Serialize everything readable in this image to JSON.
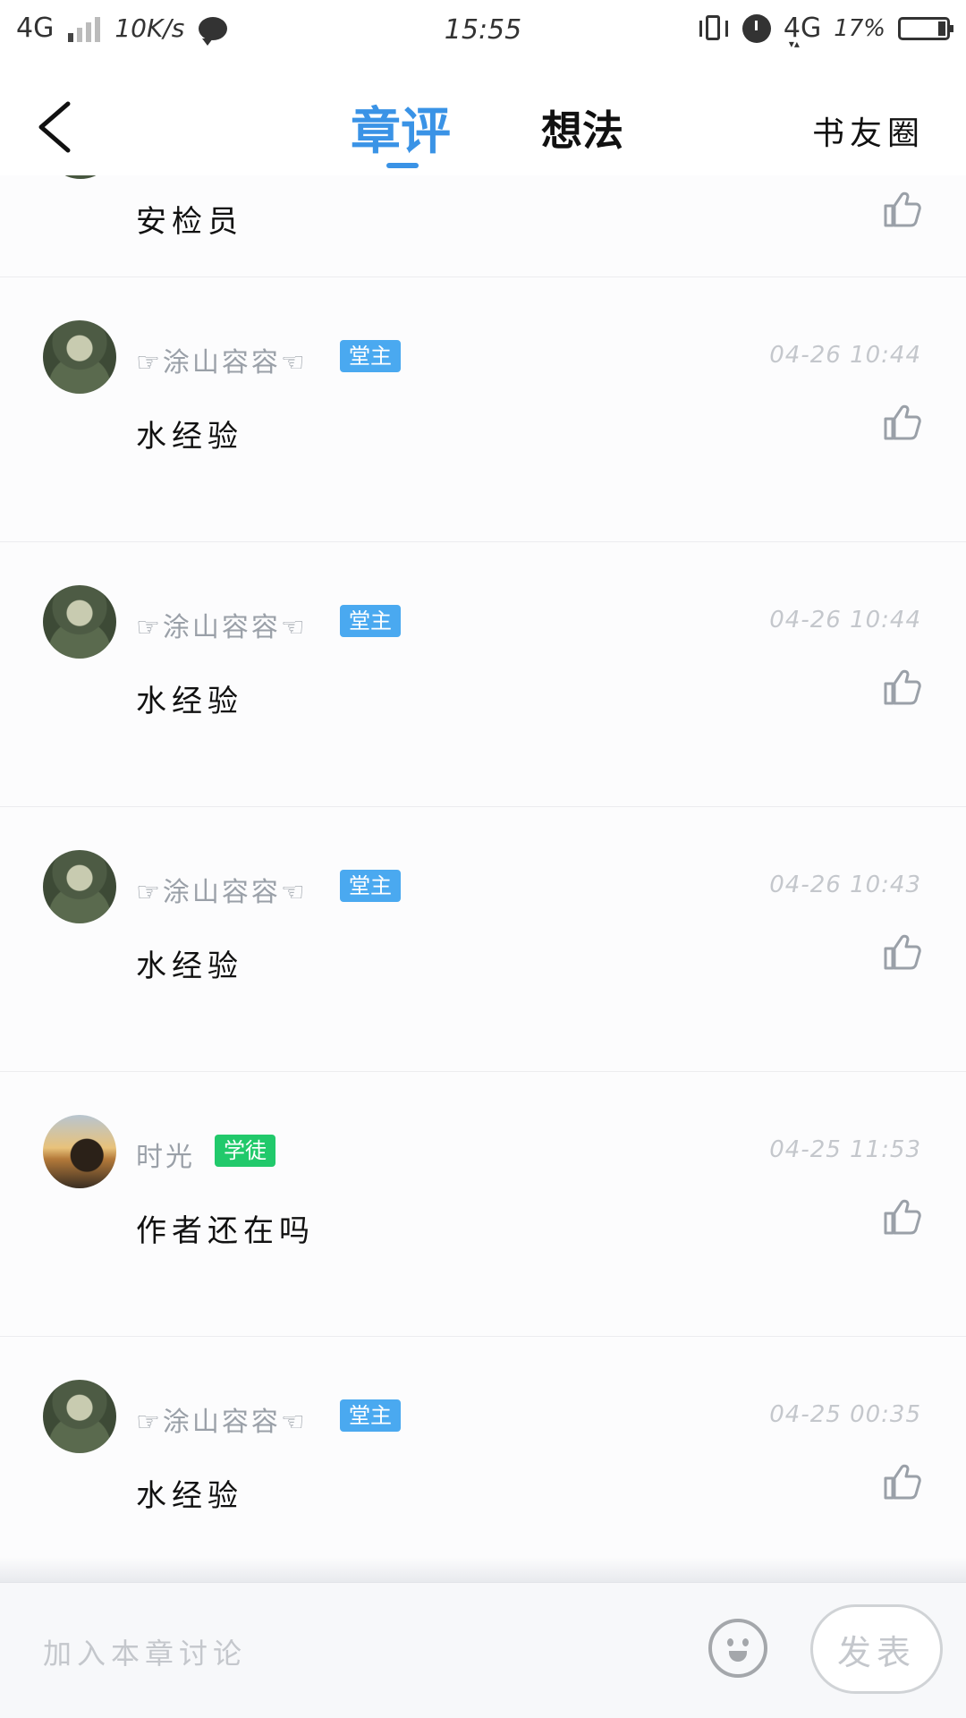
{
  "status_bar": {
    "network_type": "4G",
    "net_speed": "10K/s",
    "time": "15:55",
    "network_type_right": "4G",
    "battery_percent": "17%",
    "battery_level": 0.17,
    "icons": [
      "signal-icon",
      "chat-bubble-icon",
      "vibrate-icon",
      "alarm-icon",
      "battery-icon"
    ]
  },
  "header": {
    "back_icon": "chevron-left-icon",
    "tabs": [
      {
        "label": "章评",
        "active": true
      },
      {
        "label": "想法",
        "active": false
      }
    ],
    "circle_link": "书友圈"
  },
  "colors": {
    "accent": "#3a93e6",
    "badge_blue": "#4aa9f0",
    "badge_green": "#21c96b",
    "muted_text": "#9aa0a8",
    "timestamp": "#c4c7cc"
  },
  "comments": [
    {
      "text": "安检员",
      "like_icon": "thumbs-up-icon"
    },
    {
      "user": "☞涂山容容☜",
      "badge": "堂主",
      "badge_color": "blue",
      "time": "04-26 10:44",
      "text": "水经验",
      "like_icon": "thumbs-up-icon"
    },
    {
      "user": "☞涂山容容☜",
      "badge": "堂主",
      "badge_color": "blue",
      "time": "04-26 10:44",
      "text": "水经验",
      "like_icon": "thumbs-up-icon"
    },
    {
      "user": "☞涂山容容☜",
      "badge": "堂主",
      "badge_color": "blue",
      "time": "04-26 10:43",
      "text": "水经验",
      "like_icon": "thumbs-up-icon"
    },
    {
      "user": "时光",
      "badge": "学徒",
      "badge_color": "green",
      "time": "04-25 11:53",
      "text": "作者还在吗",
      "like_icon": "thumbs-up-icon"
    },
    {
      "user": "☞涂山容容☜",
      "badge": "堂主",
      "badge_color": "blue",
      "time": "04-25 00:35",
      "text": "水经验",
      "like_icon": "thumbs-up-icon"
    }
  ],
  "bottom_bar": {
    "input_placeholder": "加入本章讨论",
    "emoji_icon": "smiley-icon",
    "send_label": "发表"
  }
}
